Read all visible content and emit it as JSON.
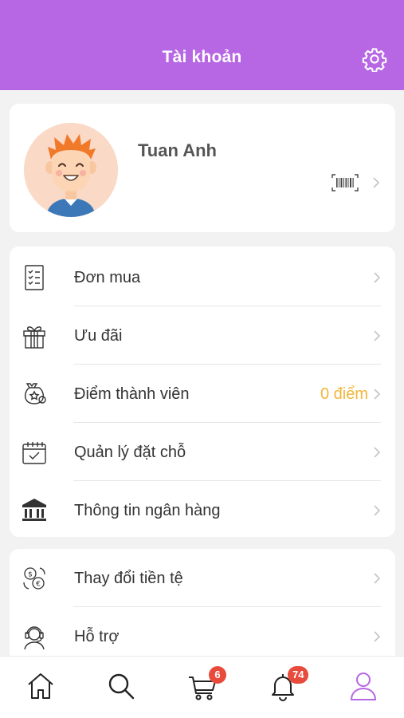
{
  "header": {
    "title": "Tài khoản",
    "settings_icon": "gear-icon"
  },
  "profile": {
    "name": "Tuan Anh",
    "avatar_icon": "avatar-illustration",
    "barcode_icon": "barcode-icon"
  },
  "menu_group_1": [
    {
      "label": "Đơn mua",
      "icon": "order-list-icon"
    },
    {
      "label": "Ưu đãi",
      "icon": "gift-icon"
    },
    {
      "label": "Điểm thành viên",
      "icon": "points-bag-icon",
      "value": "0 điểm"
    },
    {
      "label": "Quản lý đặt chỗ",
      "icon": "calendar-check-icon"
    },
    {
      "label": "Thông tin ngân hàng",
      "icon": "bank-icon"
    }
  ],
  "menu_group_2": [
    {
      "label": "Thay đổi tiền tệ",
      "icon": "currency-exchange-icon"
    },
    {
      "label": "Hỗ trợ",
      "icon": "support-headset-icon"
    }
  ],
  "tabbar": {
    "tabs": [
      {
        "name": "home",
        "icon": "home-icon"
      },
      {
        "name": "search",
        "icon": "search-icon"
      },
      {
        "name": "cart",
        "icon": "cart-icon",
        "badge": "6"
      },
      {
        "name": "notifications",
        "icon": "bell-icon",
        "badge": "74"
      },
      {
        "name": "account",
        "icon": "user-icon",
        "active": true
      }
    ]
  },
  "colors": {
    "brand": "#b767e3",
    "accent_value": "#f2b63c",
    "badge": "#e84b3c"
  }
}
